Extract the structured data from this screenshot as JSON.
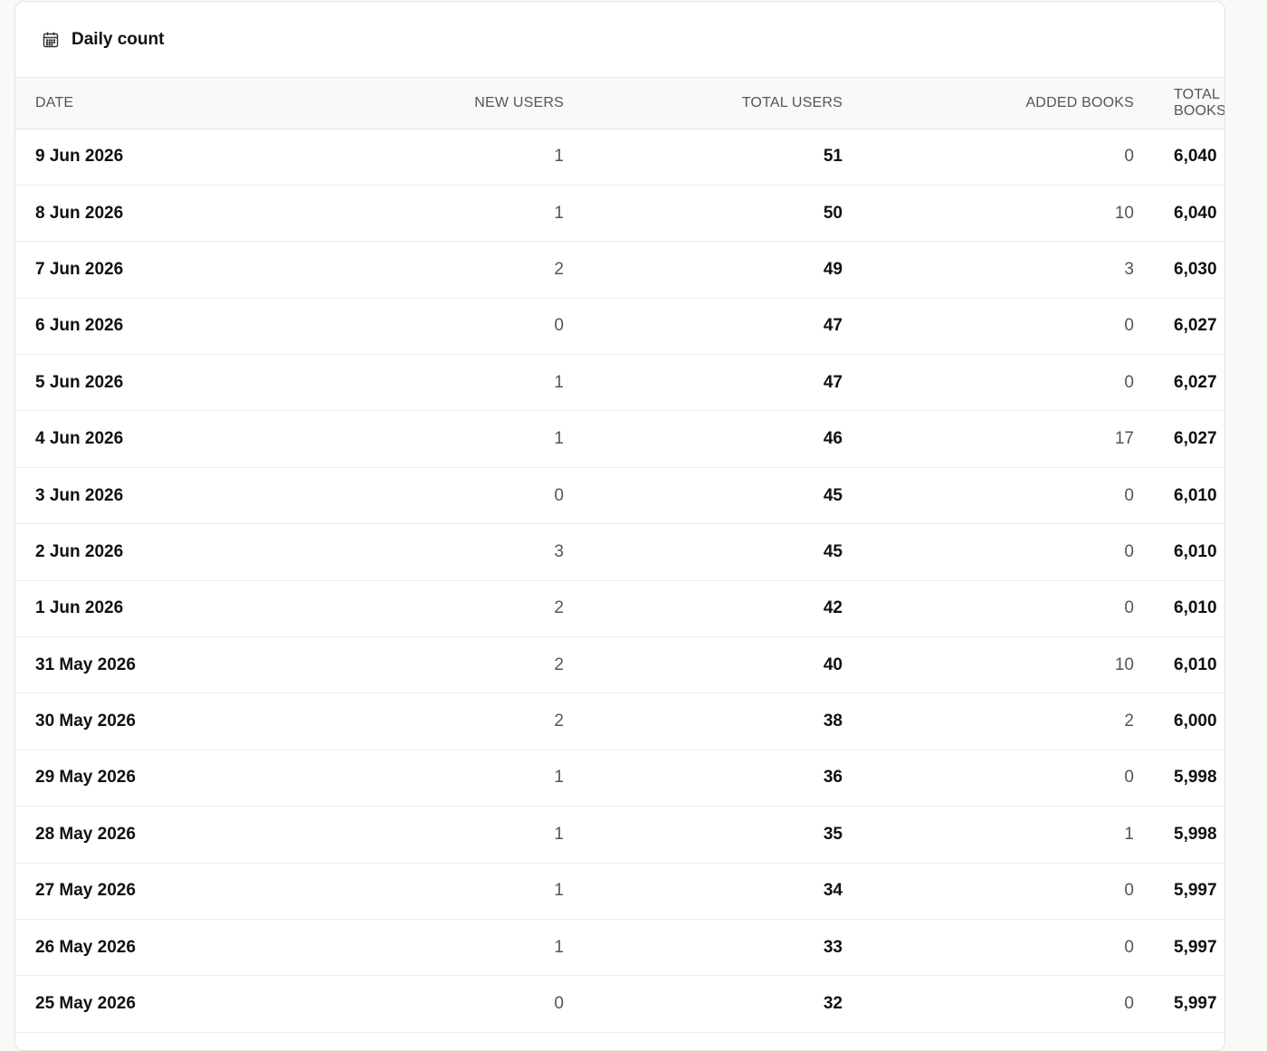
{
  "card": {
    "title": "Daily count",
    "icon": "calendar-icon"
  },
  "table": {
    "headers": [
      "DATE",
      "NEW USERS",
      "TOTAL USERS",
      "ADDED BOOKS",
      "TOTAL BOOKS"
    ],
    "rows": [
      {
        "date": "9 Jun 2026",
        "new_users": "1",
        "total_users": "51",
        "added_books": "0",
        "total_books": "6,040"
      },
      {
        "date": "8 Jun 2026",
        "new_users": "1",
        "total_users": "50",
        "added_books": "10",
        "total_books": "6,040"
      },
      {
        "date": "7 Jun 2026",
        "new_users": "2",
        "total_users": "49",
        "added_books": "3",
        "total_books": "6,030"
      },
      {
        "date": "6 Jun 2026",
        "new_users": "0",
        "total_users": "47",
        "added_books": "0",
        "total_books": "6,027"
      },
      {
        "date": "5 Jun 2026",
        "new_users": "1",
        "total_users": "47",
        "added_books": "0",
        "total_books": "6,027"
      },
      {
        "date": "4 Jun 2026",
        "new_users": "1",
        "total_users": "46",
        "added_books": "17",
        "total_books": "6,027"
      },
      {
        "date": "3 Jun 2026",
        "new_users": "0",
        "total_users": "45",
        "added_books": "0",
        "total_books": "6,010"
      },
      {
        "date": "2 Jun 2026",
        "new_users": "3",
        "total_users": "45",
        "added_books": "0",
        "total_books": "6,010"
      },
      {
        "date": "1 Jun 2026",
        "new_users": "2",
        "total_users": "42",
        "added_books": "0",
        "total_books": "6,010"
      },
      {
        "date": "31 May 2026",
        "new_users": "2",
        "total_users": "40",
        "added_books": "10",
        "total_books": "6,010"
      },
      {
        "date": "30 May 2026",
        "new_users": "2",
        "total_users": "38",
        "added_books": "2",
        "total_books": "6,000"
      },
      {
        "date": "29 May 2026",
        "new_users": "1",
        "total_users": "36",
        "added_books": "0",
        "total_books": "5,998"
      },
      {
        "date": "28 May 2026",
        "new_users": "1",
        "total_users": "35",
        "added_books": "1",
        "total_books": "5,998"
      },
      {
        "date": "27 May 2026",
        "new_users": "1",
        "total_users": "34",
        "added_books": "0",
        "total_books": "5,997"
      },
      {
        "date": "26 May 2026",
        "new_users": "1",
        "total_users": "33",
        "added_books": "0",
        "total_books": "5,997"
      },
      {
        "date": "25 May 2026",
        "new_users": "0",
        "total_users": "32",
        "added_books": "0",
        "total_books": "5,997"
      }
    ]
  }
}
